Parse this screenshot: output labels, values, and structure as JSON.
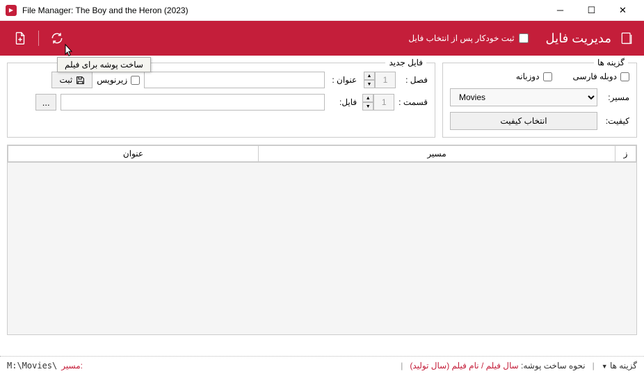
{
  "window": {
    "title": "File Manager: The Boy and the Heron (2023)"
  },
  "toolbar": {
    "title": "مدیریت فایل",
    "autosave_label": "ثبت خودکار پس از انتخاب فایل",
    "tooltip": "ساخت پوشه برای فیلم"
  },
  "options": {
    "panel_title": "گزینه ها",
    "dub_fa": "دوبله فارسی",
    "bilingual": "دوزبانه",
    "path_label": "مسیر:",
    "path_value": "Movies",
    "quality_label": "کیفیت:",
    "quality_btn": "انتخاب کیفیت"
  },
  "newfile": {
    "panel_title": "فایل جدید",
    "season_label": "فصل :",
    "season_value": "1",
    "episode_label": "قسمت :",
    "episode_value": "1",
    "title_label": "عنوان :",
    "file_label": "فایل:",
    "subtitle_label": "زیرنویس",
    "save_label": "ثبت",
    "browse": "..."
  },
  "table": {
    "col_sub": "ز",
    "col_path": "مسیر",
    "col_title": "عنوان"
  },
  "statusbar": {
    "options": "گزینه ها",
    "folder_pattern_label": "نحوه ساخت پوشه:",
    "folder_pattern": "سال فیلم / نام فیلم (سال تولید)",
    "path_label": ":مسیر",
    "path": "M:\\Movies\\"
  }
}
